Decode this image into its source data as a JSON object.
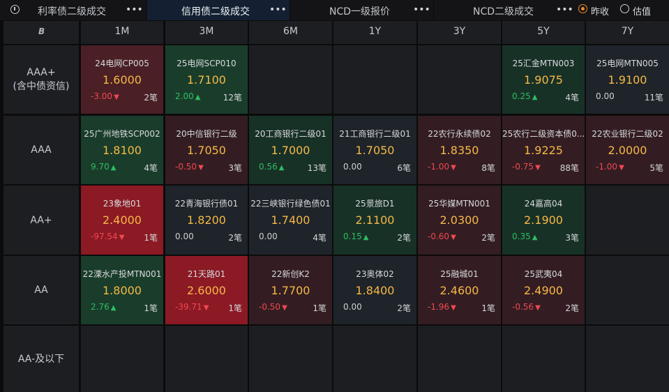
{
  "tabs": [
    {
      "label": "利率债二级成交",
      "active": false
    },
    {
      "label": "信用债二级成交",
      "active": true
    },
    {
      "label": "NCD一级报价",
      "active": false
    },
    {
      "label": "NCD二级成交",
      "active": false
    }
  ],
  "more_glyph": "•••",
  "radio_options": [
    {
      "label": "昨收",
      "checked": true
    },
    {
      "label": "估值",
      "checked": false
    }
  ],
  "corner_icon_name": "logo-icon",
  "columns": [
    "1M",
    "3M",
    "6M",
    "1Y",
    "3Y",
    "5Y",
    "7Y"
  ],
  "rows": [
    {
      "label_lines": [
        "AAA+",
        "(含中债资信)"
      ]
    },
    {
      "label_lines": [
        "AAA"
      ]
    },
    {
      "label_lines": [
        "AA+"
      ]
    },
    {
      "label_lines": [
        "AA"
      ]
    },
    {
      "label_lines": [
        "AA-及以下"
      ]
    }
  ],
  "cells": [
    [
      {
        "name": "24电网CP005",
        "rate": "1.6000",
        "change": "-3.00",
        "dir": "down",
        "count": "2笔",
        "tone": "c-r2"
      },
      {
        "name": "25电网SCP010",
        "rate": "1.7100",
        "change": "2.00",
        "dir": "up",
        "count": "12笔",
        "tone": "c-g2"
      },
      null,
      null,
      null,
      {
        "name": "25汇金MTN003",
        "rate": "1.9075",
        "change": "0.25",
        "dir": "up",
        "count": "4笔",
        "tone": "c-g1"
      },
      {
        "name": "25电网MTN005",
        "rate": "1.9100",
        "change": "0.00",
        "dir": "flat",
        "count": "11笔",
        "tone": "c-flat"
      }
    ],
    [
      {
        "name": "25广州地铁SCP002",
        "rate": "1.8100",
        "change": "9.70",
        "dir": "up",
        "count": "4笔",
        "tone": "c-g2"
      },
      {
        "name": "20中信银行二级",
        "rate": "1.7050",
        "change": "-0.50",
        "dir": "down",
        "count": "3笔",
        "tone": "c-r1"
      },
      {
        "name": "20工商银行二级01",
        "rate": "1.7000",
        "change": "0.56",
        "dir": "up",
        "count": "13笔",
        "tone": "c-g1"
      },
      {
        "name": "21工商银行二级01",
        "rate": "1.7050",
        "change": "0.00",
        "dir": "flat",
        "count": "6笔",
        "tone": "c-flat"
      },
      {
        "name": "22农行永续债02",
        "rate": "1.8350",
        "change": "-1.00",
        "dir": "down",
        "count": "8笔",
        "tone": "c-r1"
      },
      {
        "name": "25农行二级资本债0...",
        "rate": "1.9225",
        "change": "-0.75",
        "dir": "down",
        "count": "88笔",
        "tone": "c-r1"
      },
      {
        "name": "22农业银行二级02",
        "rate": "2.0000",
        "change": "-1.00",
        "dir": "down",
        "count": "5笔",
        "tone": "c-r1"
      }
    ],
    [
      {
        "name": "23象地01",
        "rate": "2.4000",
        "change": "-97.54",
        "dir": "down",
        "count": "1笔",
        "tone": "c-r3"
      },
      {
        "name": "22青海银行债01",
        "rate": "1.8200",
        "change": "0.00",
        "dir": "flat",
        "count": "2笔",
        "tone": "c-flat"
      },
      {
        "name": "22三峡银行绿色债01",
        "rate": "1.7400",
        "change": "0.00",
        "dir": "flat",
        "count": "4笔",
        "tone": "c-flat"
      },
      {
        "name": "25景旅D1",
        "rate": "2.1100",
        "change": "0.15",
        "dir": "up",
        "count": "2笔",
        "tone": "c-g1"
      },
      {
        "name": "25华媒MTN001",
        "rate": "2.0300",
        "change": "-0.60",
        "dir": "down",
        "count": "2笔",
        "tone": "c-r1"
      },
      {
        "name": "24嘉高04",
        "rate": "2.1900",
        "change": "0.35",
        "dir": "up",
        "count": "3笔",
        "tone": "c-g1"
      },
      null
    ],
    [
      {
        "name": "22溧水产投MTN001",
        "rate": "1.8000",
        "change": "2.76",
        "dir": "up",
        "count": "1笔",
        "tone": "c-g2"
      },
      {
        "name": "21天路01",
        "rate": "2.6000",
        "change": "-39.71",
        "dir": "down",
        "count": "1笔",
        "tone": "c-r3"
      },
      {
        "name": "22新创K2",
        "rate": "1.7700",
        "change": "-0.50",
        "dir": "down",
        "count": "1笔",
        "tone": "c-r1"
      },
      {
        "name": "23奥体02",
        "rate": "1.8400",
        "change": "0.00",
        "dir": "flat",
        "count": "2笔",
        "tone": "c-flat"
      },
      {
        "name": "25融城01",
        "rate": "2.4600",
        "change": "-1.96",
        "dir": "down",
        "count": "1笔",
        "tone": "c-r1"
      },
      {
        "name": "25武夷04",
        "rate": "2.4900",
        "change": "-0.56",
        "dir": "down",
        "count": "2笔",
        "tone": "c-r1"
      },
      null
    ],
    [
      null,
      null,
      null,
      null,
      null,
      null,
      null
    ]
  ]
}
